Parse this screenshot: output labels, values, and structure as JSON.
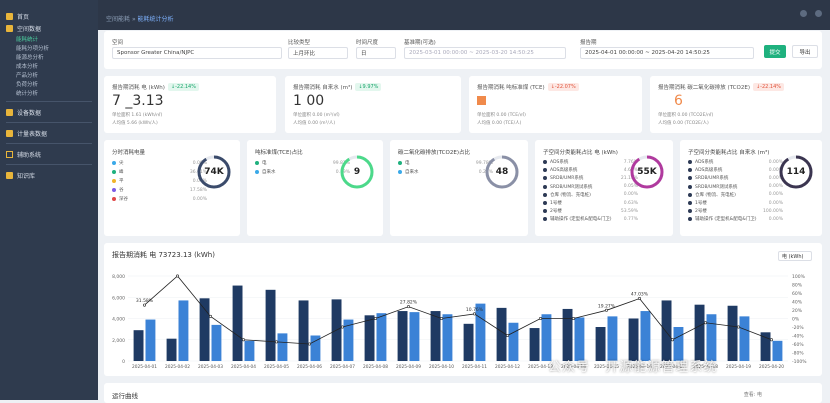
{
  "nav": {
    "breadcrumb_home": "空间能耗",
    "breadcrumb_sep": "»",
    "breadcrumb_current": "能耗统计分析",
    "items": [
      {
        "label": "首页"
      },
      {
        "label": "空间数据"
      },
      {
        "label": "设备数据"
      },
      {
        "label": "计量表数据"
      },
      {
        "label": "辅助系统"
      },
      {
        "label": "知识库"
      }
    ],
    "sub_items": [
      "能耗统计",
      "能耗分项分析",
      "能源总分析",
      "成本分析",
      "产品分析",
      "负荷分析",
      "统计分析"
    ]
  },
  "filter": {
    "space_label": "空间",
    "space_value": "Sponsor Greater China/NJPC",
    "compare_label": "比较类型",
    "compare_value": "上月环比",
    "granularity_label": "时间尺度",
    "granularity_value": "日",
    "base_label": "基准期(可选)",
    "base_value": "2025-03-01 00:00:00 ~ 2025-03-20 14:50:25",
    "report_label": "报告期",
    "report_value": "2025-04-01 00:00:00 ~ 2025-04-20 14:50:25",
    "query_btn": "提交",
    "export_btn": "导出"
  },
  "kpis": [
    {
      "title": "报告期消耗 电 (kWh)",
      "badge": "↓-22.14%",
      "value": "7 _3.13",
      "s1": "单位面积 1.61 (kWh/㎡)",
      "s2": "人均值 5.66 (kWh/人)"
    },
    {
      "title": "报告期消耗 自来水 (m³)",
      "badge": "↓9.97%",
      "value": "1 00",
      "s1": "单位面积 0.00 (m³/㎡)",
      "s2": "人均值 0.00 (m³/人)"
    },
    {
      "title": "报告期消耗 吨标准煤 (TCE)",
      "badge": "↓-22.07%",
      "value": "",
      "s1": "单位面积 0.00 (TCE/㎡)",
      "s2": "人均值 0.00 (TCE/人)"
    },
    {
      "title": "报告期消耗 碳二氧化碳排放 (TCO2E)",
      "badge": "↓-22.14%",
      "value": "6",
      "s1": "单位面积 0.00 (TCO2E/㎡)",
      "s2": "人均值 0.00 (TCO2E/人)"
    }
  ],
  "donuts": [
    {
      "title": "分时消耗电量",
      "center": "74K",
      "color": "#3b4b6b",
      "legend": [
        {
          "name": "尖",
          "pct": "0.00%",
          "color": "#3aa9e8"
        },
        {
          "name": "峰",
          "pct": "36.01%",
          "color": "#1fb17e"
        },
        {
          "name": "平",
          "pct": "0.00%",
          "color": "#f0b429"
        },
        {
          "name": "谷",
          "pct": "17.58%",
          "color": "#7b5ce6"
        },
        {
          "name": "深谷",
          "pct": "0.00%",
          "color": "#e04848"
        }
      ]
    },
    {
      "title": "吨标准煤(TCE)占比",
      "center": "9",
      "color": "#4cd98a",
      "legend": [
        {
          "name": "电",
          "pct": "99.81%",
          "color": "#1fb17e"
        },
        {
          "name": "自来水",
          "pct": "0.19%",
          "color": "#3aa9e8"
        }
      ]
    },
    {
      "title": "碳二氧化碳排放(TCO2E)占比",
      "center": "48",
      "color": "#8a90a6",
      "legend": [
        {
          "name": "电",
          "pct": "99.78%",
          "color": "#1fb17e"
        },
        {
          "name": "自来水",
          "pct": "0.22%",
          "color": "#3aa9e8"
        }
      ]
    },
    {
      "title": "子空间分类能耗占比 电 (kWh)",
      "center": "55K",
      "color": "#b03a9e",
      "legend": [
        {
          "name": "ADS系统",
          "pct": "7.76%",
          "color": "#2d3a55"
        },
        {
          "name": "ADS高级系统",
          "pct": "4.65%",
          "color": "#2d3a55"
        },
        {
          "name": "SRDB/UMR系统",
          "pct": "21.19%",
          "color": "#2d3a55"
        },
        {
          "name": "SRDB/UMR测试系统",
          "pct": "0.05%",
          "color": "#2d3a55"
        },
        {
          "name": "仓库 (物流、充电桩)",
          "pct": "0.00%",
          "color": "#2d3a55"
        },
        {
          "name": "1号楼",
          "pct": "0.63%",
          "color": "#2d3a55"
        },
        {
          "name": "2号楼",
          "pct": "53.59%",
          "color": "#2d3a55"
        },
        {
          "name": "辅助操作 (定型机&配电&门卫)",
          "pct": "0.77%",
          "color": "#2d3a55"
        }
      ]
    },
    {
      "title": "子空间分类能耗占比 自来水 (m³)",
      "center": "114",
      "color": "#3b3550",
      "legend": [
        {
          "name": "ADS系统",
          "pct": "0.00%",
          "color": "#2d3a55"
        },
        {
          "name": "ADS高级系统",
          "pct": "0.00%",
          "color": "#2d3a55"
        },
        {
          "name": "SRDB/UMR系统",
          "pct": "0.00%",
          "color": "#2d3a55"
        },
        {
          "name": "SRDB/UMR测试系统",
          "pct": "0.00%",
          "color": "#2d3a55"
        },
        {
          "name": "仓库 (物流、充电桩)",
          "pct": "0.00%",
          "color": "#2d3a55"
        },
        {
          "name": "1号楼",
          "pct": "0.00%",
          "color": "#2d3a55"
        },
        {
          "name": "2号楼",
          "pct": "100.00%",
          "color": "#2d3a55"
        },
        {
          "name": "辅助操作 (定型机&配电&门卫)",
          "pct": "0.00%",
          "color": "#2d3a55"
        }
      ]
    }
  ],
  "chart_title": "报告期消耗 电 73723.13 (kWh)",
  "chart_unit": "电 (kWh)",
  "chart_data": {
    "type": "bar",
    "categories": [
      "2025-04-01",
      "2025-04-02",
      "2025-04-03",
      "2025-04-04",
      "2025-04-05",
      "2025-04-06",
      "2025-04-07",
      "2025-04-08",
      "2025-04-09",
      "2025-04-10",
      "2025-04-11",
      "2025-04-12",
      "2025-04-13",
      "2025-04-14",
      "2025-04-15",
      "2025-04-16",
      "2025-04-17",
      "2025-04-18",
      "2025-04-19",
      "2025-04-20"
    ],
    "series": [
      {
        "values": [
          2900,
          2100,
          5900,
          7100,
          6700,
          5700,
          5800,
          4300,
          4700,
          4700,
          3500,
          5000,
          3100,
          4900,
          3200,
          4000,
          5700,
          5300,
          5200,
          2700
        ]
      },
      {
        "values": [
          3900,
          5700,
          3400,
          1900,
          2600,
          2400,
          3900,
          4500,
          4600,
          4400,
          5400,
          3600,
          4400,
          4100,
          4200,
          4700,
          3200,
          4400,
          4200,
          1900
        ]
      }
    ],
    "line": [
      31.58,
      100,
      5,
      -50,
      -55,
      -60,
      -20,
      0,
      27.82,
      0,
      10.76,
      -40,
      0,
      0,
      19.27,
      47.03,
      -50,
      -10,
      -20,
      -50
    ],
    "ylim": [
      0,
      8000
    ],
    "y2lim": [
      -100,
      100
    ],
    "yticks": [
      "8,000",
      "6,000",
      "4,000",
      "2,000",
      "0"
    ],
    "y2ticks": [
      "100%",
      "80%",
      "60%",
      "40%",
      "20%",
      "0%",
      "-20%",
      "-40%",
      "-60%",
      "-80%",
      "-100%"
    ],
    "labels": {
      "0": "31.58%",
      "8": "27.82%",
      "10": "10.76%",
      "14": "19.27%",
      "15": "47.03%"
    }
  },
  "colors": {
    "dark_bar": "#1f3a63",
    "light_bar": "#3b82d6",
    "line": "#222"
  },
  "run_title": "运行曲线",
  "run_right": "查看: 电"
}
